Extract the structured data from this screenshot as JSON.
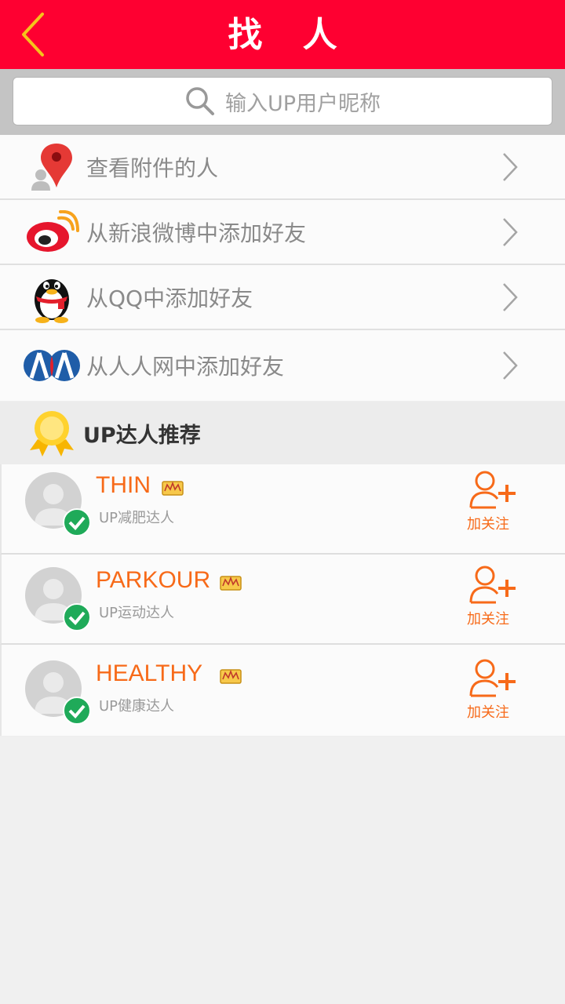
{
  "header": {
    "title": "找 人",
    "back_icon": "back-chevron-icon",
    "bg_color": "#fe0031"
  },
  "search": {
    "placeholder": "输入UP用户昵称",
    "icon": "search-icon"
  },
  "menu": {
    "items": [
      {
        "label": "查看附件的人",
        "icon": "location-pin-icon"
      },
      {
        "label": "从新浪微博中添加好友",
        "icon": "weibo-icon"
      },
      {
        "label": "从QQ中添加好友",
        "icon": "qq-penguin-icon"
      },
      {
        "label": "从人人网中添加好友",
        "icon": "renren-icon"
      }
    ]
  },
  "recommend": {
    "title": "UP达人推荐",
    "icon": "medal-icon",
    "people": [
      {
        "name": "THIN",
        "tag": "UP减肥达人",
        "follow_label": "加关注"
      },
      {
        "name": "PARKOUR",
        "tag": "UP运动达人",
        "follow_label": "加关注"
      },
      {
        "name": "HEALTHY",
        "tag": "UP健康达人",
        "follow_label": "加关注"
      }
    ]
  },
  "colors": {
    "accent": "#f76a19",
    "verified": "#1faa59",
    "header": "#fe0031"
  }
}
